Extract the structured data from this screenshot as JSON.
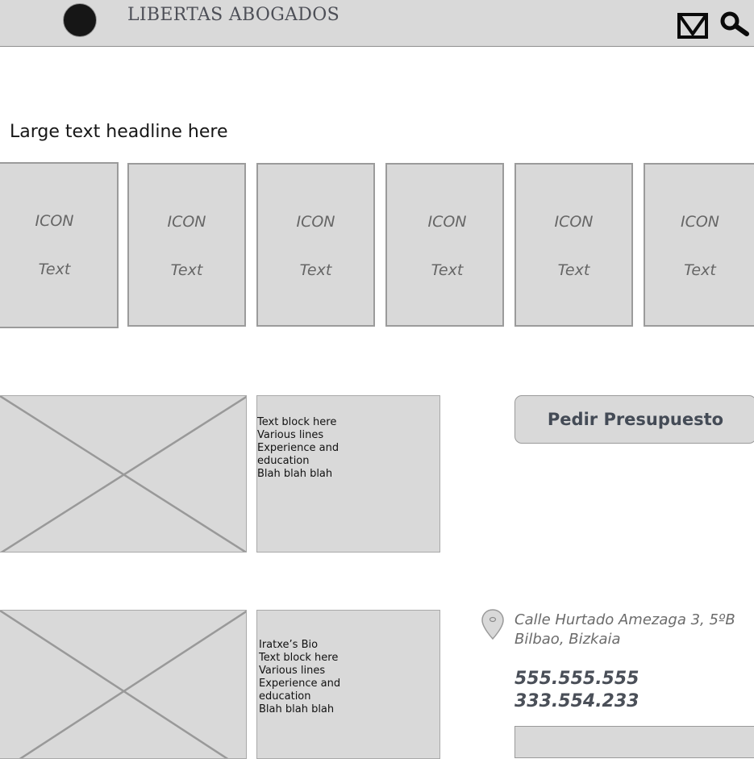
{
  "header": {
    "brand": "LIBERTAS ABOGADOS",
    "logo_icon": "circle-logo-icon",
    "mail_icon": "mail-icon",
    "search_icon": "search-icon"
  },
  "main": {
    "headline": "Large text headline here",
    "tiles": [
      {
        "icon": "ICON",
        "text": "Text"
      },
      {
        "icon": "ICON",
        "text": "Text"
      },
      {
        "icon": "ICON",
        "text": "Text"
      },
      {
        "icon": "ICON",
        "text": "Text"
      },
      {
        "icon": "ICON",
        "text": "Text"
      },
      {
        "icon": "ICON",
        "text": "Text"
      }
    ],
    "profile1": {
      "lines": [
        "Text block here",
        "Various lines",
        "Experience and",
        "education",
        "Blah blah blah"
      ]
    },
    "profile2": {
      "lines": [
        "Iratxe’s Bio",
        "Text block here",
        "Various lines",
        "Experience and",
        "education",
        "Blah blah blah"
      ]
    },
    "cta_label": "Pedir Presupuesto",
    "contact": {
      "address_line1": "Calle Hurtado Amezaga 3, 5ºB",
      "address_line2": "Bilbao, Bizkaia",
      "phone1": "555.555.555",
      "phone2": "333.554.233",
      "pin_icon": "map-pin-icon"
    }
  },
  "colors": {
    "panel": "#d9d9d9",
    "border": "#9b9b9b",
    "brand_text": "#4d4f57",
    "cta_text": "#444b56"
  }
}
